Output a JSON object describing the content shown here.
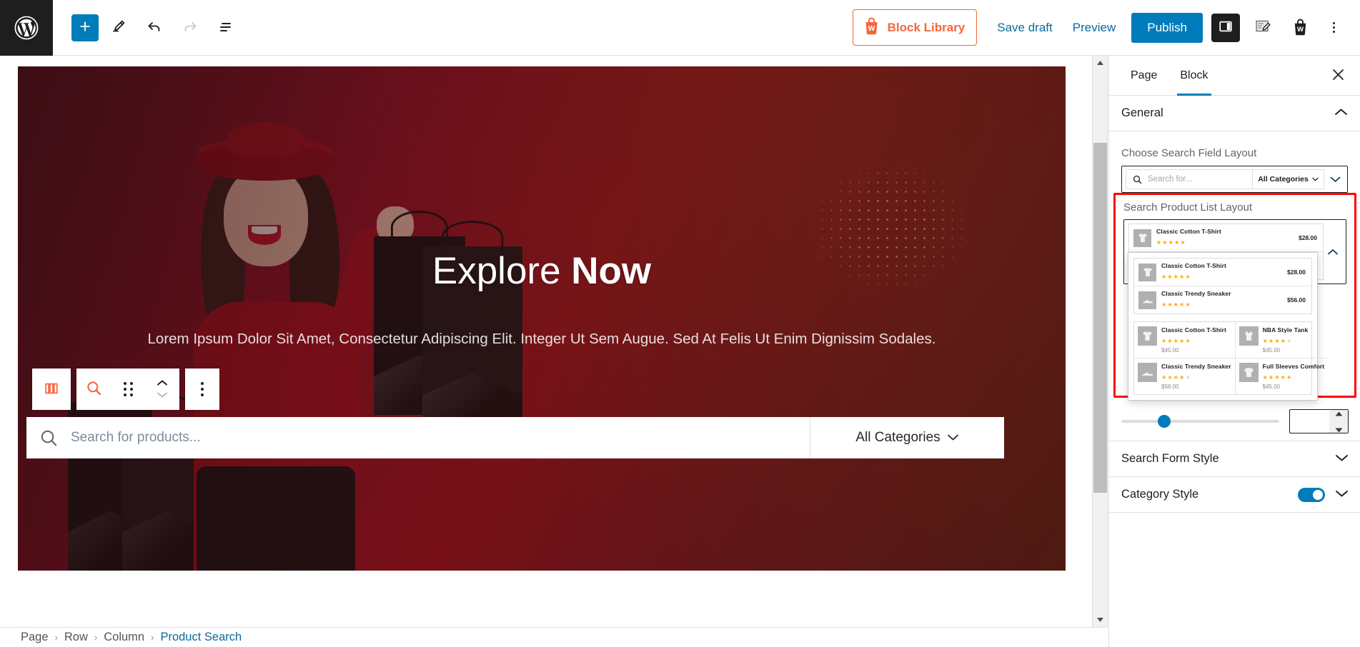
{
  "topbar": {
    "logo_icon": "wordpress-logo-icon",
    "left_tools": [
      {
        "name": "add-block-button",
        "icon": "plus-icon"
      },
      {
        "name": "edit-tool-button",
        "icon": "pencil-icon"
      },
      {
        "name": "undo-button",
        "icon": "undo-arrow-icon"
      },
      {
        "name": "redo-button",
        "icon": "redo-arrow-icon"
      },
      {
        "name": "document-overview-button",
        "icon": "list-view-icon"
      }
    ],
    "block_library_label": "Block Library",
    "block_library_icon": "shopping-bag-w-icon",
    "save_draft_label": "Save draft",
    "preview_label": "Preview",
    "publish_label": "Publish",
    "settings_icon": "sidebar-panel-icon",
    "edit_doc_icon": "document-pencil-icon",
    "bag_icon": "shopping-bag-icon",
    "more_icon": "kebab-menu-icon",
    "accent_blue": "#007cba",
    "accent_orange": "#f4663e"
  },
  "hero": {
    "title_plain": "Explore ",
    "title_bold": "Now",
    "subtitle": "Lorem Ipsum Dolor Sit Amet, Consectetur Adipiscing Elit. Integer Ut Sem Augue. Sed At Felis Ut Enim Dignissim Sodales.",
    "search_placeholder": "Search for products...",
    "search_icon": "search-magnifier-icon",
    "category_label": "All Categories",
    "category_chevron": "chevron-down-icon"
  },
  "block_toolbar": {
    "columns_icon": "columns-block-icon",
    "block_type_icon": "product-search-icon",
    "drag_icon": "drag-handle-icon",
    "move_up_icon": "chevron-up-icon",
    "move_down_icon": "chevron-down-icon",
    "options_icon": "kebab-menu-icon"
  },
  "breadcrumb": {
    "items": [
      "Page",
      "Row",
      "Column",
      "Product Search"
    ],
    "separator": "›"
  },
  "sidebar": {
    "tabs": [
      {
        "label": "Page",
        "active": false
      },
      {
        "label": "Block",
        "active": true
      }
    ],
    "close_icon": "close-x-icon",
    "panel_title": "General",
    "panel_chevron": "chevron-up-icon",
    "search_field_layout_label": "Choose Search Field Layout",
    "search_field_preview": {
      "search_icon": "search-magnifier-icon",
      "placeholder": "Search for...",
      "category_label": "All Categories",
      "category_chevron": "chevron-down-icon",
      "select_chevron": "chevron-down-icon"
    },
    "product_list_layout_label": "Search Product List Layout",
    "highlight_color": "#ff0000",
    "selected_layout_chevron": "chevron-up-icon",
    "selected_layout": {
      "type": "list",
      "products": [
        {
          "name": "Classic Cotton T-Shirt",
          "price": "$28.00",
          "rating": 5,
          "thumb_icon": "tshirt-icon"
        },
        {
          "name": "Classic Trendy Sneaker",
          "price": "$56.00",
          "rating": 5,
          "thumb_icon": "sneaker-icon"
        }
      ]
    },
    "layout_options": [
      {
        "type": "list",
        "products": [
          {
            "name": "Classic Cotton T-Shirt",
            "price": "$28.00",
            "rating": 5,
            "thumb_icon": "tshirt-icon"
          },
          {
            "name": "Classic Trendy Sneaker",
            "price": "$56.00",
            "rating": 5,
            "thumb_icon": "sneaker-icon"
          }
        ]
      },
      {
        "type": "grid",
        "products": [
          {
            "name": "Classic Cotton T-Shirt",
            "price": "$45.00",
            "rating": 5,
            "thumb_icon": "tshirt-icon"
          },
          {
            "name": "NBA Style Tank",
            "price": "$45.00",
            "rating": 4,
            "thumb_icon": "tank-top-icon"
          },
          {
            "name": "Classic Trendy Sneaker",
            "price": "$58.00",
            "rating": 4,
            "thumb_icon": "sneaker-icon"
          },
          {
            "name": "Full Sleeves Comfort",
            "price": "$45.00",
            "rating": 5,
            "thumb_icon": "sweater-icon"
          }
        ]
      }
    ],
    "slider": {
      "value": "",
      "percent": 27,
      "up_icon": "spinner-up-icon",
      "down_icon": "spinner-down-icon"
    },
    "rows": [
      {
        "label": "Search Form Style",
        "chevron": "chevron-down-icon",
        "toggle": false
      },
      {
        "label": "Category Style",
        "chevron": "chevron-down-icon",
        "toggle": true
      }
    ]
  }
}
